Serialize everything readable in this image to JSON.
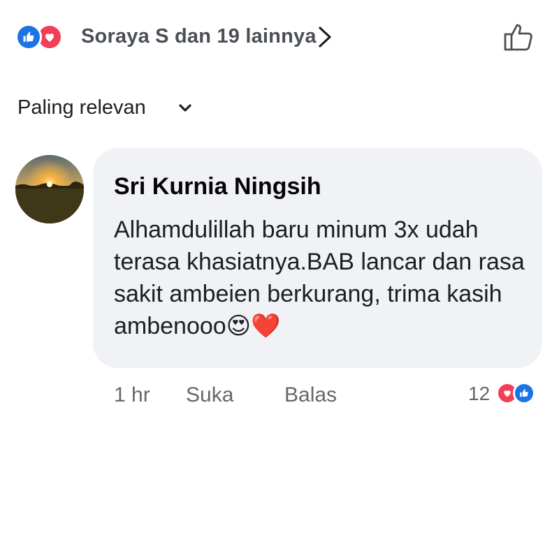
{
  "header": {
    "reactors_text": "Soraya S dan 19 lainnya",
    "icons": [
      "like-reaction-icon",
      "love-reaction-icon",
      "chevron-right-icon",
      "like-outline-icon"
    ]
  },
  "sort": {
    "label": "Paling relevan",
    "icon": "chevron-down-icon"
  },
  "comment": {
    "author": "Sri Kurnia Ningsih",
    "text": "Alhamdulillah baru minum 3x udah terasa khasiatnya.BAB lancar dan rasa sakit ambeien berkurang, trima kasih ambenooo😍❤️",
    "time": "1 hr",
    "like_label": "Suka",
    "reply_label": "Balas",
    "reaction_count": "12",
    "reaction_icons": [
      "love-reaction-icon",
      "like-reaction-icon"
    ]
  },
  "colors": {
    "like_blue": "#1b74e4",
    "love_red": "#f33e58",
    "bubble_bg": "#f0f2f5",
    "secondary_text": "#65676b"
  }
}
